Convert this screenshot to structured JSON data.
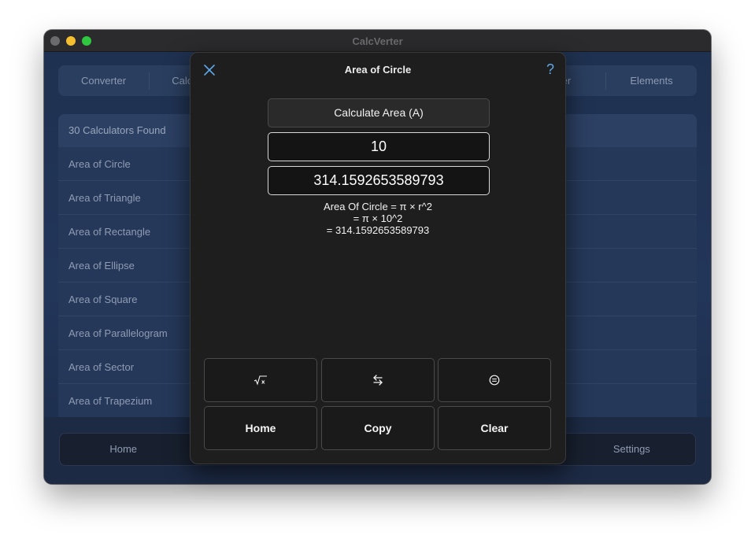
{
  "window": {
    "title": "CalcVerter"
  },
  "topnav": {
    "items": [
      "Converter",
      "Calculator",
      "",
      "",
      "",
      "User",
      "Elements"
    ]
  },
  "list": {
    "header": "30 Calculators Found",
    "items": [
      "Area of Circle",
      "Area of Triangle",
      "Area of Rectangle",
      "Area of Ellipse",
      "Area of Square",
      "Area of Parallelogram",
      "Area of Sector",
      "Area of Trapezium"
    ]
  },
  "tabbar": {
    "items": [
      "Home",
      "",
      "",
      "",
      "Settings"
    ]
  },
  "modal": {
    "title": "Area of Circle",
    "help": "?",
    "calc_label": "Calculate Area (A)",
    "input_value": "10",
    "result_value": "314.1592653589793",
    "formula": [
      "Area Of Circle = π × r^2",
      "=  π × 10^2",
      "= 314.1592653589793"
    ],
    "buttons": {
      "sqrt": "sqrt-icon",
      "swap": "swap-arrows-icon",
      "equals": "equals-circle-icon",
      "home": "Home",
      "copy": "Copy",
      "clear": "Clear"
    }
  }
}
